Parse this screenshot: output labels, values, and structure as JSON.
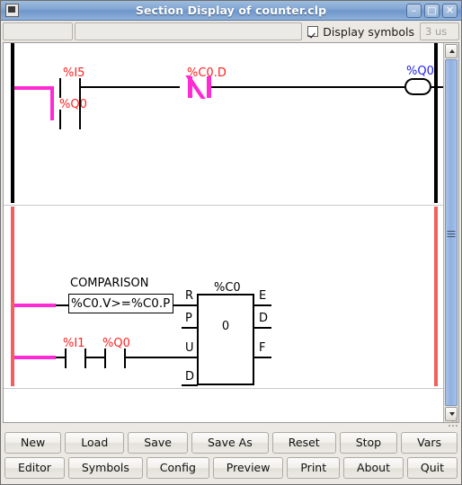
{
  "window": {
    "title": "Section Display of counter.clp",
    "icon": "window-icon",
    "controls": [
      {
        "name": "minimize",
        "glyph": "–"
      },
      {
        "name": "maximize",
        "glyph": "□"
      },
      {
        "name": "close",
        "glyph": "✕"
      }
    ]
  },
  "toolbar": {
    "field_a_value": "",
    "field_b_value": "",
    "display_symbols_label": "Display symbols",
    "display_symbols_checked": true,
    "cycle_time": "3 us"
  },
  "ladder": {
    "rung1": {
      "rail_color": "#000000",
      "power_color": "#ff2ad4",
      "contacts": [
        {
          "name": "contact-i5",
          "label": "%I5",
          "type": "NO",
          "energized": true
        },
        {
          "name": "contact-q0-branch",
          "label": "%Q0",
          "type": "NO",
          "energized": true
        },
        {
          "name": "contact-c0d",
          "label": "%C0.D",
          "type": "NC",
          "energized": true
        }
      ],
      "coil": {
        "name": "coil-q0",
        "label": "%Q0"
      }
    },
    "rung2": {
      "rail_color": "#f06060",
      "comparison": {
        "title": "COMPARISON",
        "expression": "%C0.V>=%C0.P"
      },
      "contacts": [
        {
          "name": "contact-i1",
          "label": "%I1",
          "type": "NO"
        },
        {
          "name": "contact-q0",
          "label": "%Q0",
          "type": "NO"
        }
      ],
      "block": {
        "name": "%C0",
        "value": "0",
        "inputs": [
          "R",
          "P",
          "U",
          "D"
        ],
        "outputs": [
          "E",
          "D",
          "F"
        ]
      }
    }
  },
  "scrollbar": {
    "up_arrow": "scroll-up-arrow",
    "down_arrow": "scroll-down-arrow"
  },
  "buttons": {
    "row1": [
      "New",
      "Load",
      "Save",
      "Save As",
      "Reset",
      "Stop",
      "Vars"
    ],
    "row2": [
      "Editor",
      "Symbols",
      "Config",
      "Preview",
      "Print",
      "About",
      "Quit"
    ]
  }
}
